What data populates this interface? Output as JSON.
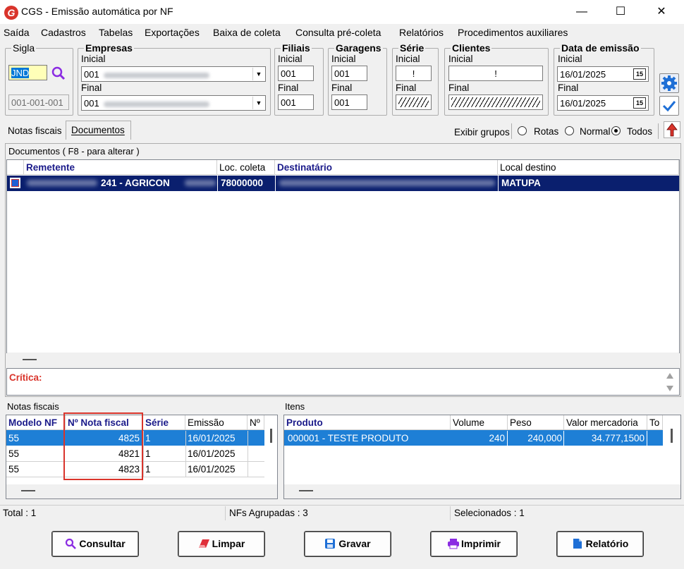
{
  "window": {
    "title": "CGS - Emissão automática por NF",
    "minimize": "—",
    "maximize": "☐",
    "close": "✕"
  },
  "menu": [
    "Saída",
    "Cadastros",
    "Tabelas",
    "Exportações",
    "Baixa de coleta",
    "Consulta pré-coleta",
    "Relatórios",
    "Procedimentos auxiliares"
  ],
  "filters": {
    "sigla": {
      "legend": "Sigla",
      "value": "JND",
      "code": "001-001-001"
    },
    "empresas": {
      "legend": "Empresas",
      "inicial_label": "Inicial",
      "final_label": "Final",
      "inicial": "001",
      "final": "001"
    },
    "filiais": {
      "legend": "Filiais",
      "inicial_label": "Inicial",
      "final_label": "Final",
      "inicial": "001",
      "final": "001"
    },
    "garagens": {
      "legend": "Garagens",
      "inicial_label": "Inicial",
      "final_label": "Final",
      "inicial": "001",
      "final": "001"
    },
    "serie": {
      "legend": "Série",
      "inicial_label": "Inicial",
      "final_label": "Final",
      "inicial": "!"
    },
    "clientes": {
      "legend": "Clientes",
      "inicial_label": "Inicial",
      "final_label": "Final",
      "inicial": "!"
    },
    "data": {
      "legend": "Data de emissão",
      "inicial_label": "Inicial",
      "final_label": "Final",
      "inicial": "16/01/2025",
      "final": "16/01/2025",
      "cal": "15"
    }
  },
  "tabs": {
    "notas": "Notas fiscais",
    "documentos": "Documentos"
  },
  "grupos": {
    "label": "Exibir grupos",
    "rotas": "Rotas",
    "normal": "Normal",
    "todos": "Todos"
  },
  "documentos": {
    "caption": "Documentos ( F8 - para alterar )",
    "columns": [
      "Remetente",
      "Loc. coleta",
      "Destinatário",
      "Local destino"
    ],
    "rows": [
      {
        "remetente": "241 - AGRICON",
        "loc_coleta": "78000000",
        "destinatario": "",
        "local_destino": "MATUPA"
      }
    ]
  },
  "critica": {
    "label": "Crítica:"
  },
  "notas": {
    "caption": "Notas fiscais",
    "columns": [
      "Modelo NF",
      "Nº Nota fiscal",
      "Série",
      "Emissão",
      "Nº"
    ],
    "rows": [
      {
        "modelo": "55",
        "numero": "4825",
        "serie": "1",
        "emissao": "16/01/2025"
      },
      {
        "modelo": "55",
        "numero": "4821",
        "serie": "1",
        "emissao": "16/01/2025"
      },
      {
        "modelo": "55",
        "numero": "4823",
        "serie": "1",
        "emissao": "16/01/2025"
      }
    ]
  },
  "itens": {
    "caption": "Itens",
    "columns": [
      "Produto",
      "Volume",
      "Peso",
      "Valor mercadoria",
      "To"
    ],
    "rows": [
      {
        "produto": "000001 - TESTE PRODUTO",
        "volume": "240",
        "peso": "240,000",
        "valor": "34.777,1500"
      }
    ]
  },
  "status": {
    "total": "Total : 1",
    "agrupadas": "NFs Agrupadas : 3",
    "selecionados": "Selecionados : 1"
  },
  "buttons": {
    "consultar": "Consultar",
    "limpar": "Limpar",
    "gravar": "Gravar",
    "imprimir": "Imprimir",
    "relatorio": "Relatório"
  },
  "colors": {
    "accent": "#d9342b",
    "selection": "#0a1f6e",
    "highlight": "#1e7fd6",
    "icon_purple": "#8a2be2"
  }
}
